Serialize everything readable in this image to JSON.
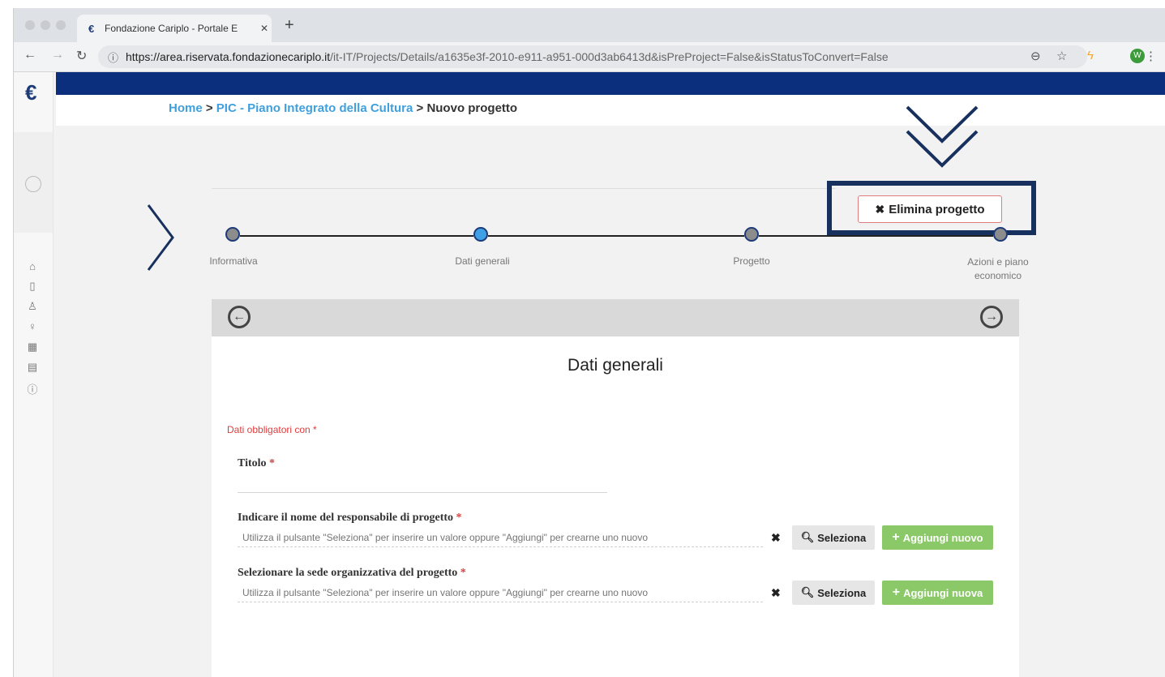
{
  "browser": {
    "tab_title": "Fondazione Cariplo - Portale E",
    "tab_close": "✕",
    "new_tab": "+",
    "url_host": "https://area.riservata.fondazionecariplo.it",
    "url_path": "/it-IT/Projects/Details/a1635e3f-2010-e911-a951-000d3ab6413d&isPreProject=False&isStatusToConvert=False",
    "profile_initial": "W"
  },
  "breadcrumb": {
    "home": "Home",
    "sep1": " > ",
    "section": "PIC - Piano Integrato della Cultura",
    "sep2": " > ",
    "current": "Nuovo progetto"
  },
  "actions": {
    "delete_label": "Elimina progetto"
  },
  "steps": [
    {
      "label": "Informativa",
      "state": "done"
    },
    {
      "label": "Dati generali",
      "state": "active"
    },
    {
      "label": "Progetto",
      "state": "todo"
    },
    {
      "label": "Azioni e piano economico",
      "state": "todo"
    }
  ],
  "form": {
    "title": "Dati generali",
    "required_note": "Dati obbligatori con *",
    "fields": [
      {
        "label": "Titolo",
        "required": "*",
        "value": ""
      },
      {
        "label": "Indicare il nome del responsabile di progetto",
        "required": "*",
        "placeholder": "Utilizza il pulsante \"Seleziona\" per inserire un valore oppure \"Aggiungi\" per crearne uno nuovo",
        "select_label": "Seleziona",
        "add_label": "Aggiungi nuovo"
      },
      {
        "label": "Selezionare la sede organizzativa del progetto",
        "required": "*",
        "placeholder": "Utilizza il pulsante \"Seleziona\" per inserire un valore oppure \"Aggiungi\" per crearne uno nuovo",
        "select_label": "Seleziona",
        "add_label": "Aggiungi nuova"
      }
    ]
  },
  "colors": {
    "topbar": "#0b2f7c",
    "link": "#3fa0dd",
    "required": "#e03c3c",
    "add_button": "#8bc867",
    "annotation": "#17305e"
  }
}
